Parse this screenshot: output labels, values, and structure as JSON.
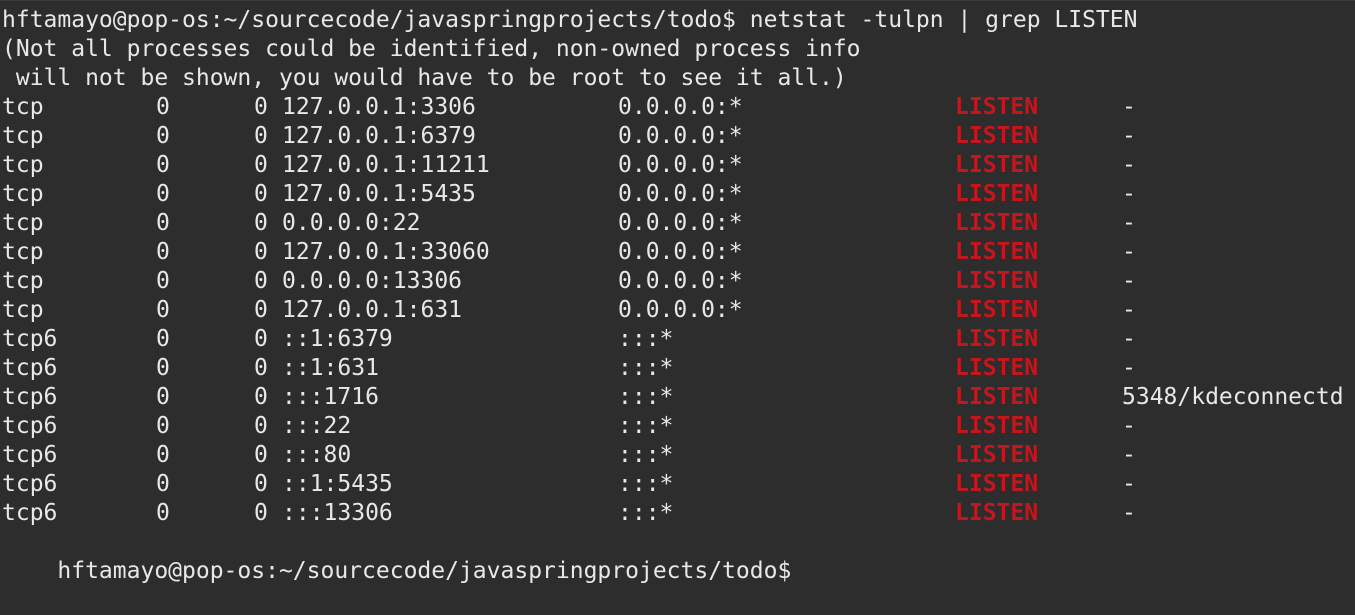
{
  "terminal": {
    "command_line": "hftamayo@pop-os:~/sourcecode/javaspringprojects/todo$ netstat -tulpn | grep LISTEN",
    "warning_line_1": "(Not all processes could be identified, non-owned process info",
    "warning_line_2": " will not be shown, you would have to be root to see it all.)",
    "rows": [
      {
        "proto": "tcp",
        "recvq": "0",
        "sendq": "0",
        "local": "127.0.0.1:3306",
        "foreign": "0.0.0.0:*",
        "state": "LISTEN",
        "pid": "-"
      },
      {
        "proto": "tcp",
        "recvq": "0",
        "sendq": "0",
        "local": "127.0.0.1:6379",
        "foreign": "0.0.0.0:*",
        "state": "LISTEN",
        "pid": "-"
      },
      {
        "proto": "tcp",
        "recvq": "0",
        "sendq": "0",
        "local": "127.0.0.1:11211",
        "foreign": "0.0.0.0:*",
        "state": "LISTEN",
        "pid": "-"
      },
      {
        "proto": "tcp",
        "recvq": "0",
        "sendq": "0",
        "local": "127.0.0.1:5435",
        "foreign": "0.0.0.0:*",
        "state": "LISTEN",
        "pid": "-"
      },
      {
        "proto": "tcp",
        "recvq": "0",
        "sendq": "0",
        "local": "0.0.0.0:22",
        "foreign": "0.0.0.0:*",
        "state": "LISTEN",
        "pid": "-"
      },
      {
        "proto": "tcp",
        "recvq": "0",
        "sendq": "0",
        "local": "127.0.0.1:33060",
        "foreign": "0.0.0.0:*",
        "state": "LISTEN",
        "pid": "-"
      },
      {
        "proto": "tcp",
        "recvq": "0",
        "sendq": "0",
        "local": "0.0.0.0:13306",
        "foreign": "0.0.0.0:*",
        "state": "LISTEN",
        "pid": "-"
      },
      {
        "proto": "tcp",
        "recvq": "0",
        "sendq": "0",
        "local": "127.0.0.1:631",
        "foreign": "0.0.0.0:*",
        "state": "LISTEN",
        "pid": "-"
      },
      {
        "proto": "tcp6",
        "recvq": "0",
        "sendq": "0",
        "local": "::1:6379",
        "foreign": ":::*",
        "state": "LISTEN",
        "pid": "-"
      },
      {
        "proto": "tcp6",
        "recvq": "0",
        "sendq": "0",
        "local": "::1:631",
        "foreign": ":::*",
        "state": "LISTEN",
        "pid": "-"
      },
      {
        "proto": "tcp6",
        "recvq": "0",
        "sendq": "0",
        "local": ":::1716",
        "foreign": ":::*",
        "state": "LISTEN",
        "pid": "5348/kdeconnectd"
      },
      {
        "proto": "tcp6",
        "recvq": "0",
        "sendq": "0",
        "local": ":::22",
        "foreign": ":::*",
        "state": "LISTEN",
        "pid": "-"
      },
      {
        "proto": "tcp6",
        "recvq": "0",
        "sendq": "0",
        "local": ":::80",
        "foreign": ":::*",
        "state": "LISTEN",
        "pid": "-"
      },
      {
        "proto": "tcp6",
        "recvq": "0",
        "sendq": "0",
        "local": "::1:5435",
        "foreign": ":::*",
        "state": "LISTEN",
        "pid": "-"
      },
      {
        "proto": "tcp6",
        "recvq": "0",
        "sendq": "0",
        "local": ":::13306",
        "foreign": ":::*",
        "state": "LISTEN",
        "pid": "-"
      }
    ],
    "prompt_line": "hftamayo@pop-os:~/sourcecode/javaspringprojects/todo$",
    "colors": {
      "background": "#2d2d2d",
      "foreground": "#e8e8e8",
      "listen_highlight": "#c4161c"
    }
  }
}
